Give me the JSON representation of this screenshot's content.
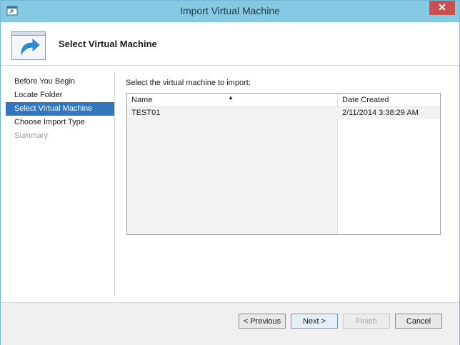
{
  "window": {
    "title": "Import Virtual Machine",
    "close_glyph": "✕"
  },
  "header": {
    "title": "Select Virtual Machine",
    "icon": "arrow-forward-icon"
  },
  "steps": [
    {
      "label": "Before You Begin",
      "state": "done"
    },
    {
      "label": "Locate Folder",
      "state": "done"
    },
    {
      "label": "Select Virtual Machine",
      "state": "active"
    },
    {
      "label": "Choose Import Type",
      "state": "pending"
    },
    {
      "label": "Summary",
      "state": "disabled"
    }
  ],
  "main": {
    "prompt": "Select the virtual machine to import:",
    "columns": [
      "Name",
      "Date Created"
    ],
    "sort_indicator": "▲",
    "rows": [
      {
        "name": "TEST01",
        "date_created": "2/11/2014 3:38:29 AM"
      }
    ]
  },
  "buttons": {
    "previous": "< Previous",
    "next": "Next >",
    "finish": "Finish",
    "cancel": "Cancel"
  },
  "colors": {
    "titlebar": "#86c9e3",
    "selection": "#3276bd",
    "close": "#c75050"
  }
}
